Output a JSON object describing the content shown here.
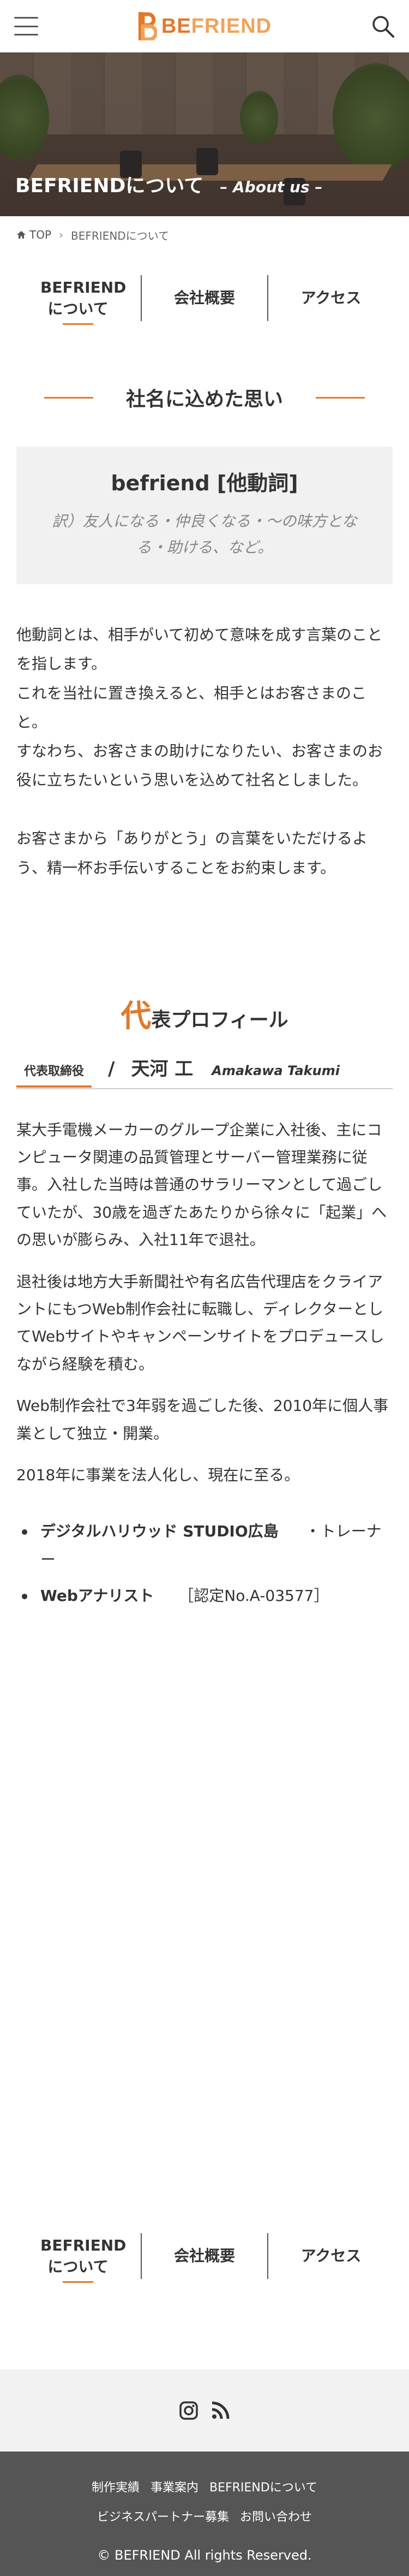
{
  "header": {
    "logo_text_be": "BE",
    "logo_text_friend": "FRIEND",
    "menu_icon": "hamburger-menu-icon",
    "search_icon": "search-icon"
  },
  "hero": {
    "title": "BEFRIENDについて",
    "subtitle": "– About us –"
  },
  "breadcrumb": {
    "home": "TOP",
    "current": "BEFRIENDについて"
  },
  "tabs": [
    {
      "label": "BEFRIENDについて",
      "active": true
    },
    {
      "label": "会社概要",
      "active": false
    },
    {
      "label": "アクセス",
      "active": false
    }
  ],
  "concept": {
    "heading": "社名に込めた思い",
    "term": "befriend [他動詞]",
    "meaning": "訳）友人になる・仲良くなる・〜の味方となる・助ける、など。",
    "para1": "他動詞とは、相手がいて初めて意味を成す言葉のことを指します。",
    "para2": "これを当社に置き換えると、相手とはお客さまのこと。",
    "para3": "すなわち、お客さまの助けになりたい、お客さまのお役に立ちたいという思いを込めて社名としました。",
    "para4": "お客さまから「ありがとう」の言葉をいただけるよう、精一杯お手伝いすることをお約束します。"
  },
  "profile": {
    "heading_first": "代",
    "heading_rest": "表プロフィール",
    "role": "代表取締役",
    "slash": "/",
    "name": "天河 工",
    "name_roman": "Amakawa Takumi",
    "p1": "某大手電機メーカーのグループ企業に入社後、主にコンピュータ関連の品質管理とサーバー管理業務に従事。入社した当時は普通のサラリーマンとして過ごしていたが、30歳を過ぎたあたりから徐々に「起業」への思いが膨らみ、入社11年で退社。",
    "p2": "退社後は地方大手新聞社や有名広告代理店をクライアントにもつWeb制作会社に転職し、ディレクターとしてWebサイトやキャンペーンサイトをプロデュースしながら経験を積む。",
    "p3": "Web制作会社で3年弱を過ごした後、2010年に個人事業として独立・開業。",
    "p4": "2018年に事業を法人化し、現在に至る。",
    "quals": [
      {
        "name": "デジタルハリウッド STUDIO広島",
        "detail": "・トレーナー"
      },
      {
        "name": "Webアナリスト",
        "detail": "［認定No.A-03577］"
      }
    ]
  },
  "bottom_tabs": [
    {
      "label": "BEFRIENDについて",
      "active": true
    },
    {
      "label": "会社概要",
      "active": false
    },
    {
      "label": "アクセス",
      "active": false
    }
  ],
  "social": {
    "instagram_icon": "instagram-icon",
    "rss_icon": "rss-icon"
  },
  "footer": {
    "links_row1": [
      "制作実績",
      "事業案内",
      "BEFRIENDについて"
    ],
    "links_row2": [
      "ビジネスパートナー募集",
      "お問い合わせ"
    ],
    "copyright": "© BEFRIEND All rights Reserved."
  },
  "colors": {
    "accent": "#e2792b",
    "footer_bg": "#555555",
    "social_bg": "#f2f2f2"
  }
}
